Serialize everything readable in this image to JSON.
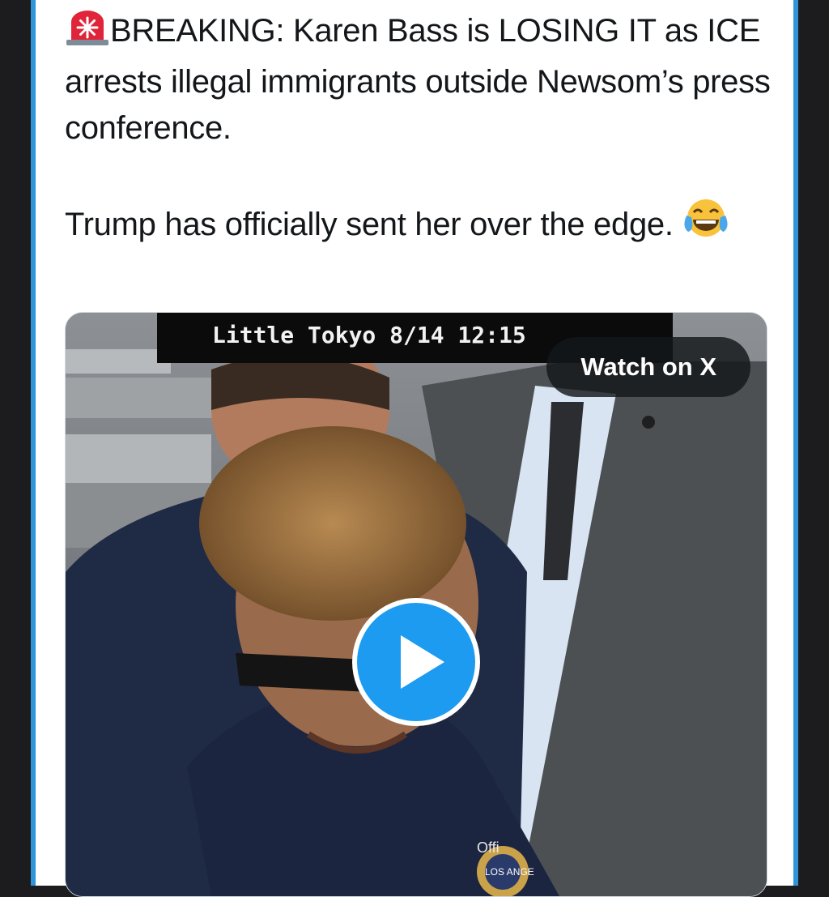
{
  "tweet": {
    "line1": "BREAKING: Karen Bass is LOSING IT as ICE arrests illegal immigrants outside Newsom’s press conference.",
    "line2": "Trump has officially sent her over the edge.",
    "siren_emoji": "siren-icon",
    "laugh_emoji": "tears-of-joy-icon"
  },
  "video": {
    "overlay_caption": "Little Tokyo 8/14 12:15",
    "watch_label": "Watch on X",
    "badge_text_top": "Offi",
    "badge_text_seal": "LOS ANGE"
  },
  "colors": {
    "accent": "#1d9bf0",
    "card_border": "#2f95d9",
    "text": "#14171a"
  }
}
